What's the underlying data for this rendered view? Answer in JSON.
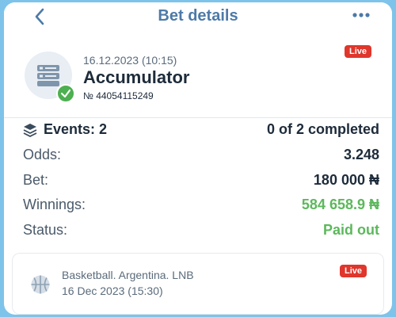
{
  "header": {
    "title": "Bet details"
  },
  "bet": {
    "date": "16.12.2023 (10:15)",
    "type": "Accumulator",
    "number": "№ 44054115249",
    "live_badge": "Live"
  },
  "summary": {
    "events_label": "Events: 2",
    "events_value": "0 of 2 completed",
    "odds_label": "Odds:",
    "odds_value": "3.248",
    "bet_label": "Bet:",
    "bet_value": "180 000 ₦",
    "winnings_label": "Winnings:",
    "winnings_value": "584 658.9 ₦",
    "status_label": "Status:",
    "status_value": "Paid out"
  },
  "event": {
    "league": "Basketball. Argentina. LNB",
    "date": "16 Dec 2023 (15:30)",
    "live_badge": "Live"
  },
  "colors": {
    "accent": "#4d7aa8",
    "success": "#5cb85c",
    "live": "#e0362c",
    "background": "#7ec3ea"
  },
  "icons": [
    "back-arrow-icon",
    "more-dots-icon",
    "receipt-icon",
    "checkmark-icon",
    "layers-icon",
    "basketball-icon"
  ]
}
